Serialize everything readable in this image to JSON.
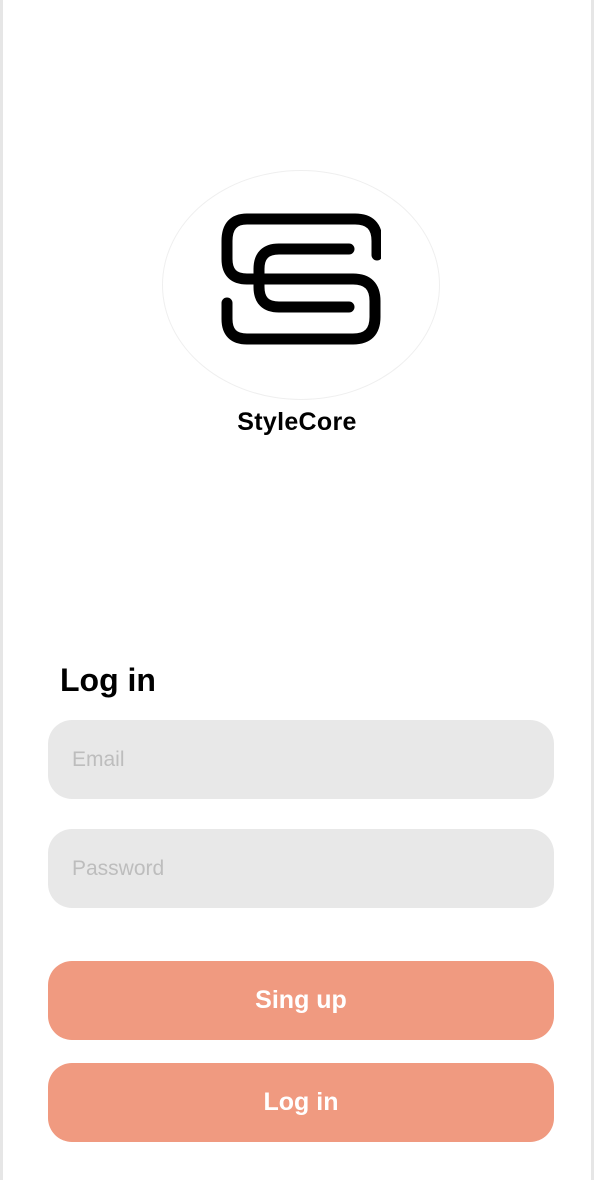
{
  "brand": {
    "name": "StyleCore",
    "logo_icon": "sc-monogram-logo"
  },
  "login_form": {
    "heading": "Log in",
    "email_placeholder": "Email",
    "password_placeholder": "Password",
    "signup_label": "Sing up",
    "login_label": "Log in"
  },
  "colors": {
    "button_bg": "#f09a80",
    "field_bg": "#e8e8e8",
    "placeholder": "#bdbdbd"
  }
}
